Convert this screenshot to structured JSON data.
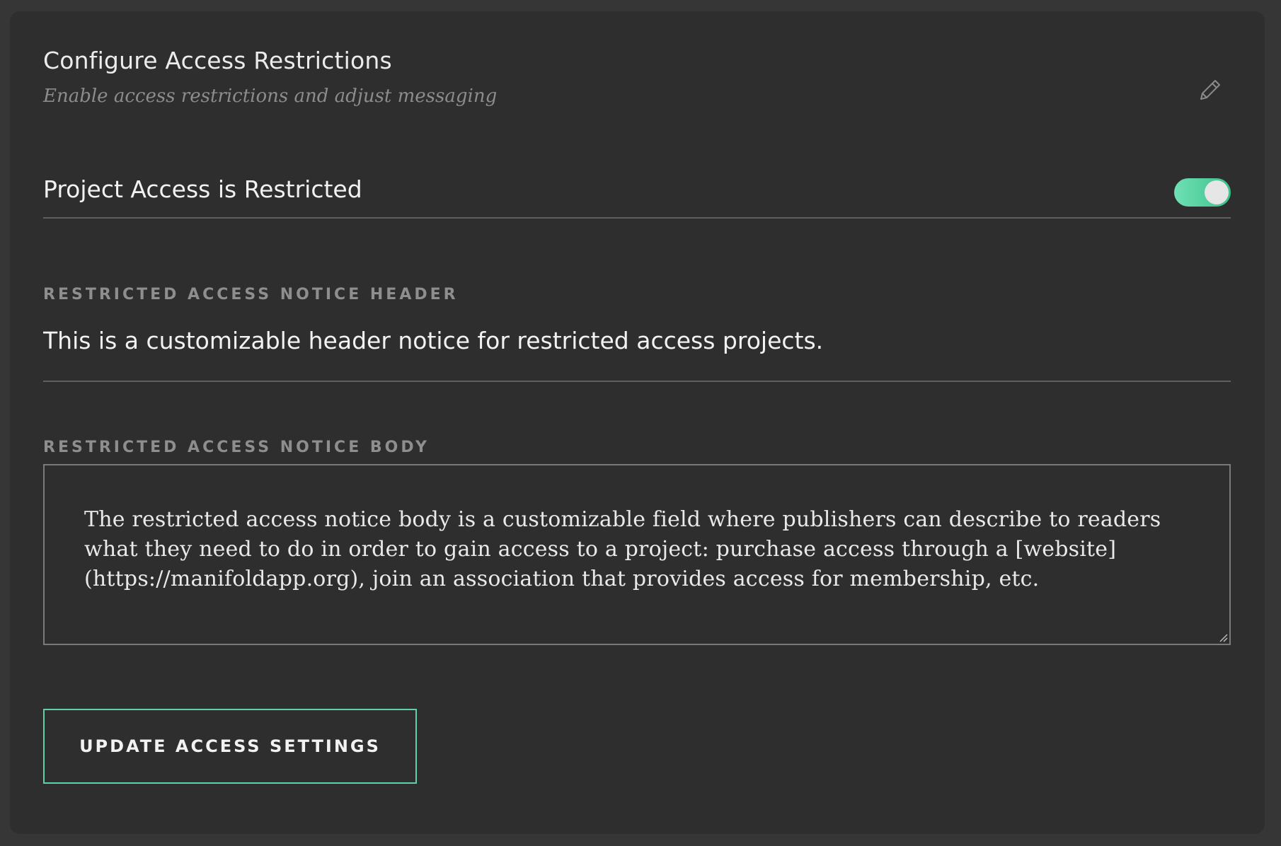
{
  "section": {
    "title": "Configure Access Restrictions",
    "subtitle": "Enable access restrictions and adjust messaging",
    "edit_icon": "pencil-icon"
  },
  "restriction_toggle": {
    "label": "Project Access is Restricted",
    "enabled": true,
    "on_color": "#4fd6a1"
  },
  "notice_header": {
    "label": "RESTRICTED ACCESS NOTICE HEADER",
    "value": "This is a customizable header notice for restricted access projects."
  },
  "notice_body": {
    "label": "RESTRICTED ACCESS NOTICE BODY",
    "value": "The restricted access notice body is a customizable field where publishers can describe to readers what they need to do in order to gain access to a project: purchase access through a [website](https://manifoldapp.org), join an association that provides access for membership, etc."
  },
  "submit": {
    "label": "UPDATE ACCESS SETTINGS",
    "border_color": "#5fd1a5"
  }
}
